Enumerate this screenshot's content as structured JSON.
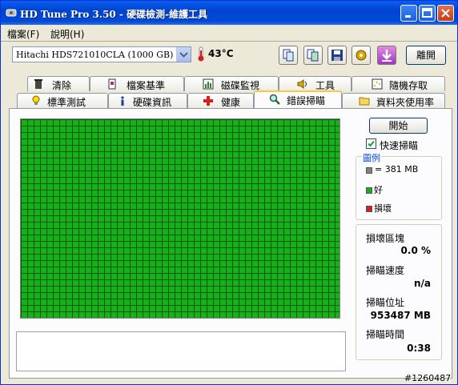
{
  "window": {
    "title": "HD Tune Pro 3.50 - 硬碟檢測-維護工具",
    "colors": {
      "titlebar": "#0054e3",
      "face": "#ece9d8",
      "grid_good": "#18b018",
      "grid_line": "#0a5a0a"
    }
  },
  "menu": {
    "file": "檔案(F)",
    "help": "說明(H)"
  },
  "toolbar": {
    "drive": "Hitachi HDS721010CLA (1000 GB)",
    "temperature": "43°C",
    "tools": [
      "copy-text-icon",
      "copy-screen-icon",
      "save-icon",
      "options-icon",
      "download-icon"
    ],
    "exit_label": "離開"
  },
  "tabs": {
    "row1": [
      "清除",
      "檔案基準",
      "磁碟監視",
      "工具",
      "隨機存取"
    ],
    "row2": [
      "標準測試",
      "硬碟資訊",
      "健康",
      "錯誤掃瞄",
      "資料夾使用率"
    ],
    "active": "錯誤掃瞄"
  },
  "scan": {
    "start_label": "開始",
    "quick_scan_label": "快速掃瞄",
    "quick_scan_checked": true,
    "legend_title": "圖例",
    "legend_block": "= 381 MB",
    "legend_good": "好",
    "legend_bad": "損壞",
    "message": ""
  },
  "stats": {
    "damaged_label": "損壞區塊",
    "damaged_value": "0.0 %",
    "speed_label": "掃瞄速度",
    "speed_value": "n/a",
    "position_label": "掃瞄位址",
    "position_value": "953487 MB",
    "time_label": "掃瞄時間",
    "time_value": "0:38"
  },
  "watermark": "#1260487"
}
